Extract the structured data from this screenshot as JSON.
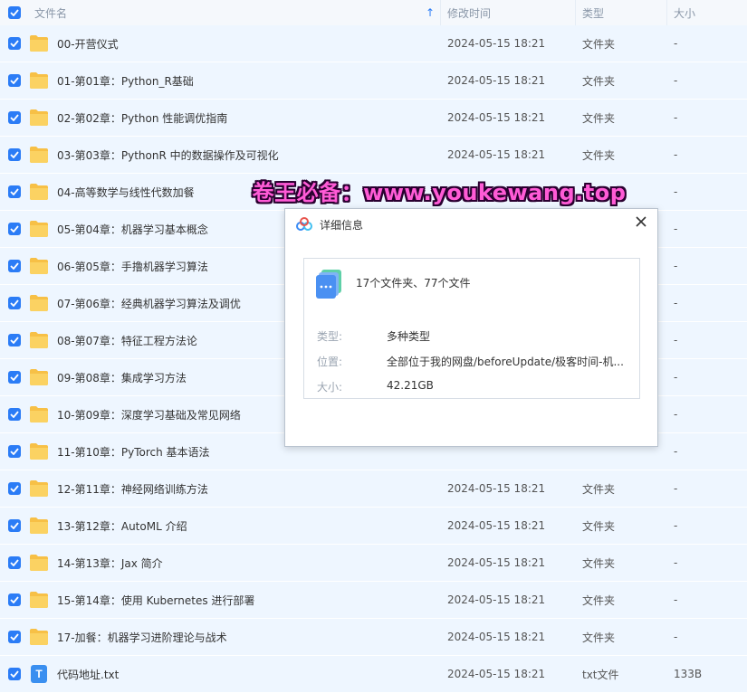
{
  "header": {
    "name_label": "文件名",
    "sort_icon": "sort-up-arrow-icon",
    "date_label": "修改时间",
    "type_label": "类型",
    "size_label": "大小"
  },
  "rows": [
    {
      "name": "00-开营仪式",
      "date": "2024-05-15 18:21",
      "type": "文件夹",
      "size": "-",
      "icon": "folder-icon"
    },
    {
      "name": "01-第01章：Python_R基础",
      "date": "2024-05-15 18:21",
      "type": "文件夹",
      "size": "-",
      "icon": "folder-icon"
    },
    {
      "name": "02-第02章：Python 性能调优指南",
      "date": "2024-05-15 18:21",
      "type": "文件夹",
      "size": "-",
      "icon": "folder-icon"
    },
    {
      "name": "03-第03章：PythonR 中的数据操作及可视化",
      "date": "2024-05-15 18:21",
      "type": "文件夹",
      "size": "-",
      "icon": "folder-icon"
    },
    {
      "name": "04-高等数学与线性代数加餐",
      "date": "",
      "type": "",
      "size": "-",
      "icon": "folder-icon"
    },
    {
      "name": "05-第04章：机器学习基本概念",
      "date": "",
      "type": "",
      "size": "-",
      "icon": "folder-icon"
    },
    {
      "name": "06-第05章：手撸机器学习算法",
      "date": "",
      "type": "",
      "size": "-",
      "icon": "folder-icon"
    },
    {
      "name": "07-第06章：经典机器学习算法及调优",
      "date": "",
      "type": "",
      "size": "-",
      "icon": "folder-icon"
    },
    {
      "name": "08-第07章：特征工程方法论",
      "date": "",
      "type": "",
      "size": "-",
      "icon": "folder-icon"
    },
    {
      "name": "09-第08章：集成学习方法",
      "date": "",
      "type": "",
      "size": "-",
      "icon": "folder-icon"
    },
    {
      "name": "10-第09章：深度学习基础及常见网络",
      "date": "",
      "type": "",
      "size": "-",
      "icon": "folder-icon"
    },
    {
      "name": "11-第10章：PyTorch 基本语法",
      "date": "",
      "type": "",
      "size": "-",
      "icon": "folder-icon"
    },
    {
      "name": "12-第11章：神经网络训练方法",
      "date": "2024-05-15 18:21",
      "type": "文件夹",
      "size": "-",
      "icon": "folder-icon"
    },
    {
      "name": "13-第12章：AutoML 介绍",
      "date": "2024-05-15 18:21",
      "type": "文件夹",
      "size": "-",
      "icon": "folder-icon"
    },
    {
      "name": "14-第13章：Jax 简介",
      "date": "2024-05-15 18:21",
      "type": "文件夹",
      "size": "-",
      "icon": "folder-icon"
    },
    {
      "name": "15-第14章：使用 Kubernetes 进行部署",
      "date": "2024-05-15 18:21",
      "type": "文件夹",
      "size": "-",
      "icon": "folder-icon"
    },
    {
      "name": "17-加餐：机器学习进阶理论与战术",
      "date": "2024-05-15 18:21",
      "type": "文件夹",
      "size": "-",
      "icon": "folder-icon"
    },
    {
      "name": "代码地址.txt",
      "date": "2024-05-15 18:21",
      "type": "txt文件",
      "size": "133B",
      "icon": "txt-file-icon",
      "icon_letter": "T"
    }
  ],
  "watermark": "卷王必备：www.youkewang.top",
  "dialog": {
    "title": "详细信息",
    "summary": "17个文件夹、77个文件",
    "type_label": "类型:",
    "type_value": "多种类型",
    "location_label": "位置:",
    "location_value": "全部位于我的网盘/beforeUpdate/极客时间-机...",
    "size_label": "大小:",
    "size_value": "42.21GB"
  },
  "colors": {
    "accent": "#2b7cf6",
    "row_selected": "#eef6ff",
    "folder": "#f7c046",
    "watermark": "#ff5bd6"
  }
}
